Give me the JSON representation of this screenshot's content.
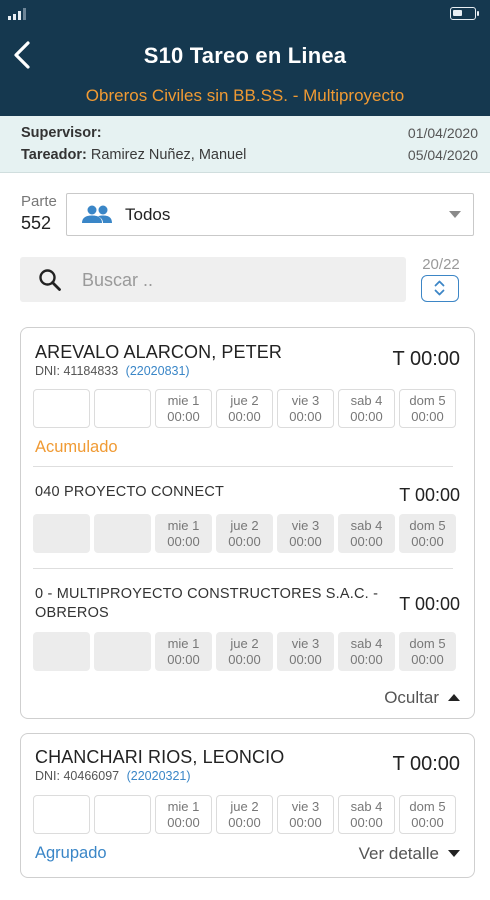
{
  "header": {
    "title": "S10 Tareo en Linea",
    "subtitle": "Obreros Civiles sin BB.SS. - Multiproyecto",
    "back_icon": "chevron-left-icon",
    "color": "#15384f",
    "accent": "#f09a33"
  },
  "info": {
    "supervisor_label": "Supervisor:",
    "supervisor_value": "",
    "start_date": "01/04/2020",
    "tareador_label": "Tareador:",
    "tareador_value": "Ramirez Nuñez, Manuel",
    "end_date": "05/04/2020"
  },
  "parte": {
    "label": "Parte",
    "number": "552"
  },
  "filter": {
    "selected": "Todos",
    "icon": "people-icon"
  },
  "search": {
    "placeholder": "Buscar ..",
    "count": "20/22"
  },
  "days": [
    {
      "label": "mie 1",
      "value": "00:00"
    },
    {
      "label": "jue 2",
      "value": "00:00"
    },
    {
      "label": "vie 3",
      "value": "00:00"
    },
    {
      "label": "sab 4",
      "value": "00:00"
    },
    {
      "label": "dom 5",
      "value": "00:00"
    }
  ],
  "workers": [
    {
      "name": "AREVALO ALARCON, PETER",
      "dni_label": "DNI:",
      "dni": "41184833",
      "code": "(22020831)",
      "total": "T 00:00",
      "status_label": "Acumulado",
      "projects": [
        {
          "name": "040 PROYECTO CONNECT",
          "total": "T 00:00"
        },
        {
          "name": "0 - MULTIPROYECTO CONSTRUCTORES S.A.C. - OBREROS",
          "total": "T 00:00"
        }
      ],
      "toggle_label": "Ocultar"
    },
    {
      "name": "CHANCHARI RIOS, LEONCIO",
      "dni_label": "DNI:",
      "dni": "40466097",
      "code": "(22020321)",
      "total": "T 00:00",
      "status_label": "Agrupado",
      "toggle_label": "Ver detalle"
    }
  ]
}
